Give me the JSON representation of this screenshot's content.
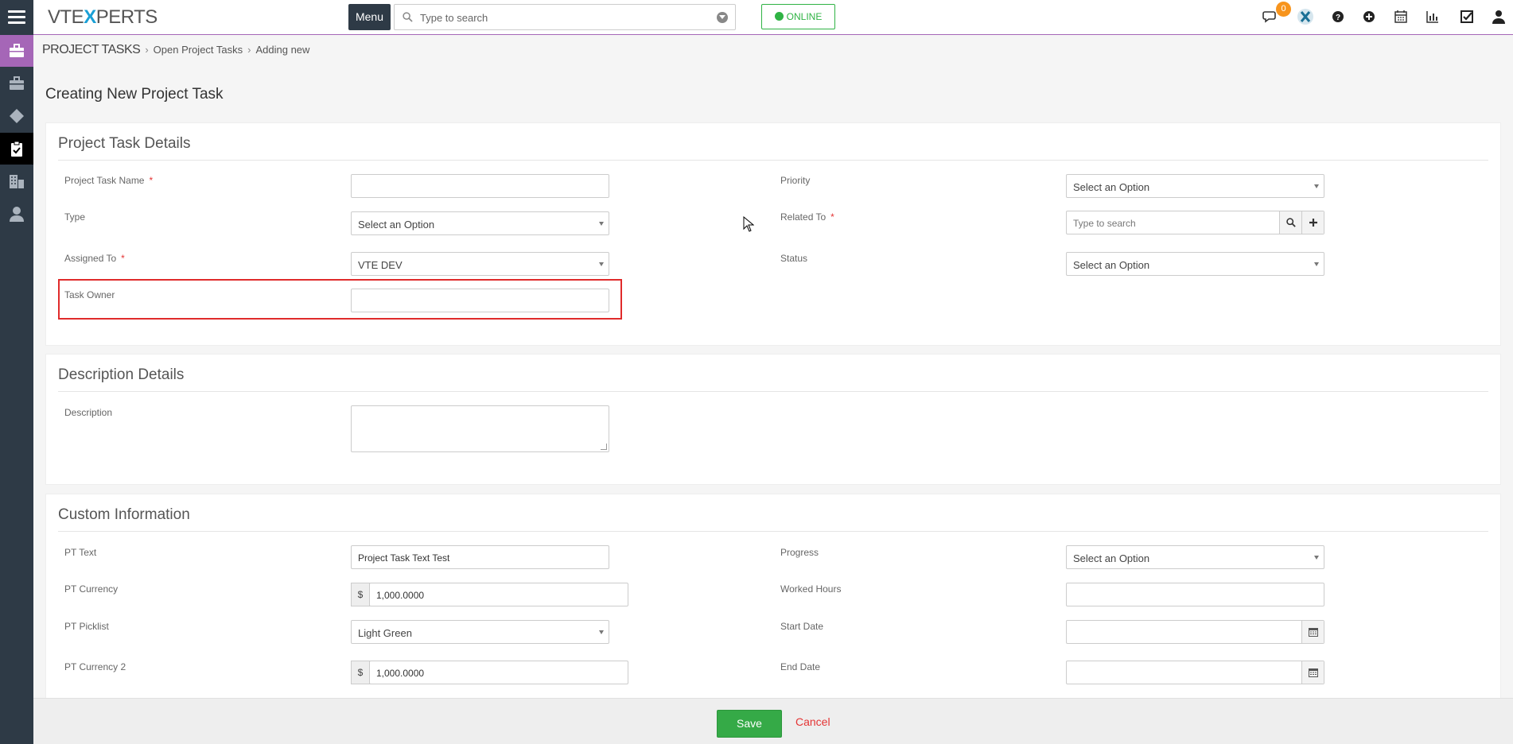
{
  "brand": {
    "logo_pre": "VTE",
    "logo_x": "X",
    "logo_post": "PERTS"
  },
  "topbar": {
    "menu_label": "Menu",
    "search_placeholder": "Type to search",
    "online_label": "ONLINE",
    "notification_count": "0",
    "icons": [
      "chat-icon",
      "vtexperts-icon",
      "help-icon",
      "add-icon",
      "calendar-icon",
      "reports-icon",
      "tasks-icon",
      "user-icon"
    ]
  },
  "sidebar": {
    "items": [
      "briefcase-icon",
      "briefcase-icon",
      "diamond-icon",
      "clipboard-icon",
      "building-icon",
      "user-icon"
    ]
  },
  "breadcrumb": {
    "module": "PROJECT TASKS",
    "list": "Open Project Tasks",
    "current": "Adding new"
  },
  "page_title": "Creating New Project Task",
  "blocks": {
    "details": {
      "title": "Project Task Details",
      "task_name_label": "Project Task Name",
      "task_name_value": "",
      "priority_label": "Priority",
      "priority_value": "Select an Option",
      "type_label": "Type",
      "type_value": "Select an Option",
      "related_label": "Related To",
      "related_placeholder": "Type to search",
      "assigned_label": "Assigned To",
      "assigned_value": "VTE DEV",
      "status_label": "Status",
      "status_value": "Select an Option",
      "owner_label": "Task Owner",
      "owner_value": "",
      "required_mark": "*"
    },
    "description": {
      "title": "Description Details",
      "label": "Description",
      "value": ""
    },
    "custom": {
      "title": "Custom Information",
      "pt_text_label": "PT Text",
      "pt_text_value": "Project Task Text Test",
      "progress_label": "Progress",
      "progress_value": "Select an Option",
      "pt_currency_label": "PT Currency",
      "currency_symbol": "$",
      "pt_currency_value": "1,000.0000",
      "worked_hours_label": "Worked Hours",
      "worked_hours_value": "",
      "pt_picklist_label": "PT Picklist",
      "pt_picklist_value": "Light Green",
      "start_date_label": "Start Date",
      "start_date_value": "",
      "pt_currency2_label": "PT Currency 2",
      "pt_currency2_value": "1,000.0000",
      "end_date_label": "End Date",
      "end_date_value": ""
    }
  },
  "footer": {
    "save_label": "Save",
    "cancel_label": "Cancel"
  },
  "colors": {
    "sidebar": "#2e3a46",
    "accent_purple": "#a566b7",
    "save_green": "#35aa47",
    "highlight_red": "#e02b2b",
    "online_green": "#2fb344"
  }
}
